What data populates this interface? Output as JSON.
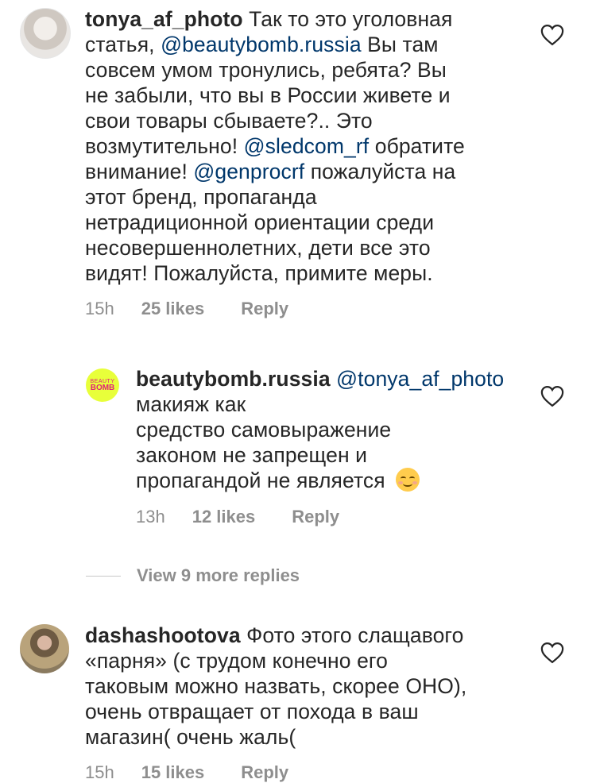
{
  "comments": [
    {
      "username": "tonya_af_photo",
      "lines": [
        [
          {
            "t": "Так то это уголовная"
          }
        ],
        [
          {
            "t": "статья, "
          },
          {
            "m": "@beautybomb.russia"
          },
          {
            "t": " Вы там"
          }
        ],
        [
          {
            "t": "совсем умом тронулись, ребята? Вы"
          }
        ],
        [
          {
            "t": "не забыли, что вы в России живете и"
          }
        ],
        [
          {
            "t": "свои товары сбываете?.. Это"
          }
        ],
        [
          {
            "t": "возмутительно! "
          },
          {
            "m": "@sledcom_rf"
          },
          {
            "t": "  обратите"
          }
        ],
        [
          {
            "t": "внимание! "
          },
          {
            "m": "@genprocrf"
          },
          {
            "t": " пожалуйста на"
          }
        ],
        [
          {
            "t": "этот бренд, пропаганда"
          }
        ],
        [
          {
            "t": "нетрадиционной ориентации среди"
          }
        ],
        [
          {
            "t": "несовершеннолетних, дети все это"
          }
        ],
        [
          {
            "t": "видят! Пожалуйста, примите меры."
          }
        ]
      ],
      "time": "15h",
      "likes": "25 likes",
      "reply": "Reply"
    },
    {
      "username": "beautybomb.russia",
      "avatar_text": [
        "BEAUTY",
        "BOMB"
      ],
      "lines": [
        [
          {
            "m": "@tonya_af_photo"
          },
          {
            "t": " макияж как"
          }
        ],
        [
          {
            "t": "средство самовыражение"
          }
        ],
        [
          {
            "t": "законом не запрещен и"
          }
        ],
        [
          {
            "t": "пропагандой не является "
          },
          {
            "e": "relieved-face-emoji"
          }
        ]
      ],
      "time": "13h",
      "likes": "12 likes",
      "reply": "Reply"
    },
    {
      "username": "dashashootova",
      "lines": [
        [
          {
            "t": "Фото этого слащавого"
          }
        ],
        [
          {
            "t": "«парня» (с трудом конечно его"
          }
        ],
        [
          {
            "t": "таковым можно назвать, скорее ОНО),"
          }
        ],
        [
          {
            "t": "очень отвращает от похода в ваш"
          }
        ],
        [
          {
            "t": "магазин( очень жаль("
          }
        ]
      ],
      "time": "15h",
      "likes": "15 likes",
      "reply": "Reply"
    }
  ],
  "view_more": "View 9 more replies",
  "colors": {
    "text": "#262626",
    "mention": "#00376b",
    "meta": "#8e8e8e",
    "brand_bg": "#e8ff3a",
    "brand_fg": "#e0207a"
  }
}
